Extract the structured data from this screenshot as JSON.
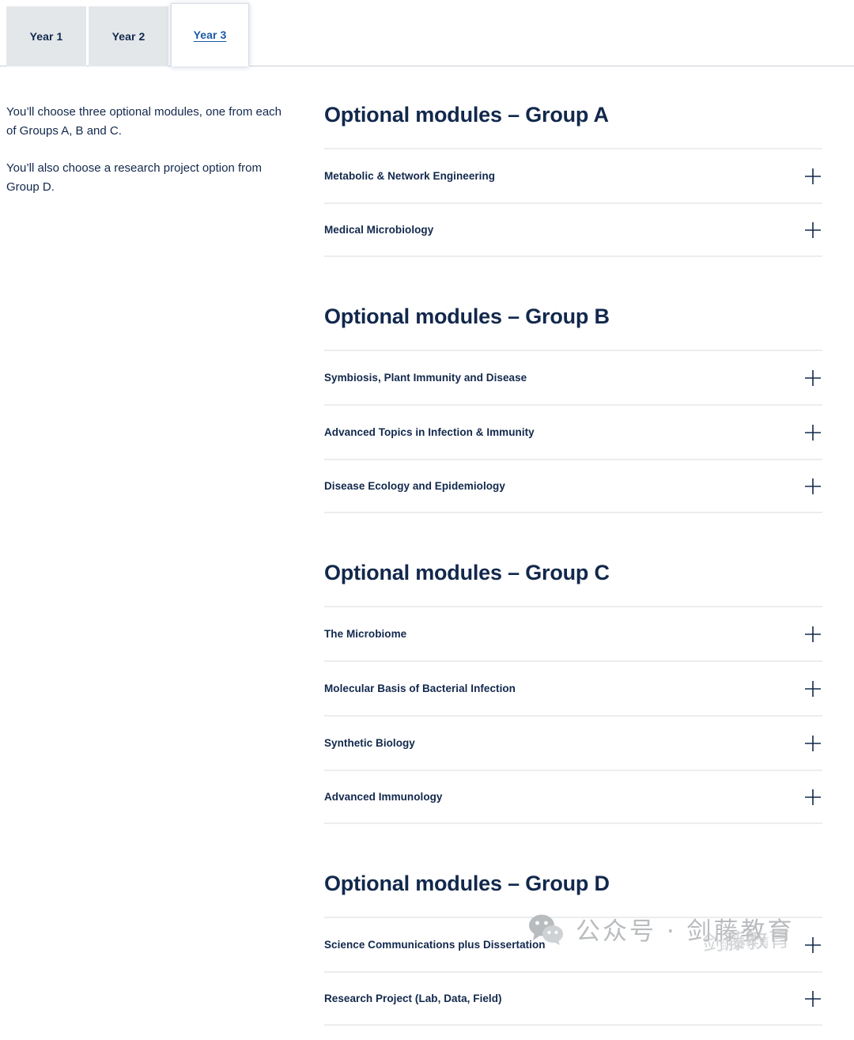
{
  "tabs": [
    {
      "label": "Year 1",
      "active": false
    },
    {
      "label": "Year 2",
      "active": false
    },
    {
      "label": "Year 3",
      "active": true
    }
  ],
  "intro": {
    "paragraph1": "You’ll choose three optional modules, one from each of Groups A, B and C.",
    "paragraph2": "You’ll also choose a research project option from Group D."
  },
  "colors": {
    "navy": "#12284c",
    "link_blue": "#1c5aa6",
    "tab_inactive_bg": "#e3e7ea",
    "divider": "#eceded",
    "tabbar_border": "#c9ced6"
  },
  "groups": [
    {
      "title": "Optional modules – Group A",
      "items": [
        {
          "label": "Metabolic & Network Engineering",
          "toggle_icon": "plus-icon"
        },
        {
          "label": "Medical Microbiology",
          "toggle_icon": "plus-icon"
        }
      ]
    },
    {
      "title": "Optional modules – Group B",
      "items": [
        {
          "label": "Symbiosis, Plant Immunity and Disease",
          "toggle_icon": "plus-icon"
        },
        {
          "label": "Advanced Topics in Infection & Immunity",
          "toggle_icon": "plus-icon"
        },
        {
          "label": "Disease Ecology and Epidemiology",
          "toggle_icon": "plus-icon"
        }
      ]
    },
    {
      "title": "Optional modules – Group C",
      "items": [
        {
          "label": "The Microbiome",
          "toggle_icon": "plus-icon"
        },
        {
          "label": "Molecular Basis of Bacterial Infection",
          "toggle_icon": "plus-icon"
        },
        {
          "label": "Synthetic Biology",
          "toggle_icon": "plus-icon"
        },
        {
          "label": "Advanced Immunology",
          "toggle_icon": "plus-icon"
        }
      ]
    },
    {
      "title": "Optional modules – Group D",
      "items": [
        {
          "label": "Science Communications plus Dissertation",
          "toggle_icon": "plus-icon"
        },
        {
          "label": "Research Project (Lab, Data, Field)",
          "toggle_icon": "plus-icon"
        }
      ]
    }
  ],
  "watermark": {
    "primary_text": "公众号 · 剑藤教育",
    "overlay_text": "剑藤教育",
    "overlay_small_text": "剑藤教育",
    "logo_icon": "wechat-icon"
  }
}
